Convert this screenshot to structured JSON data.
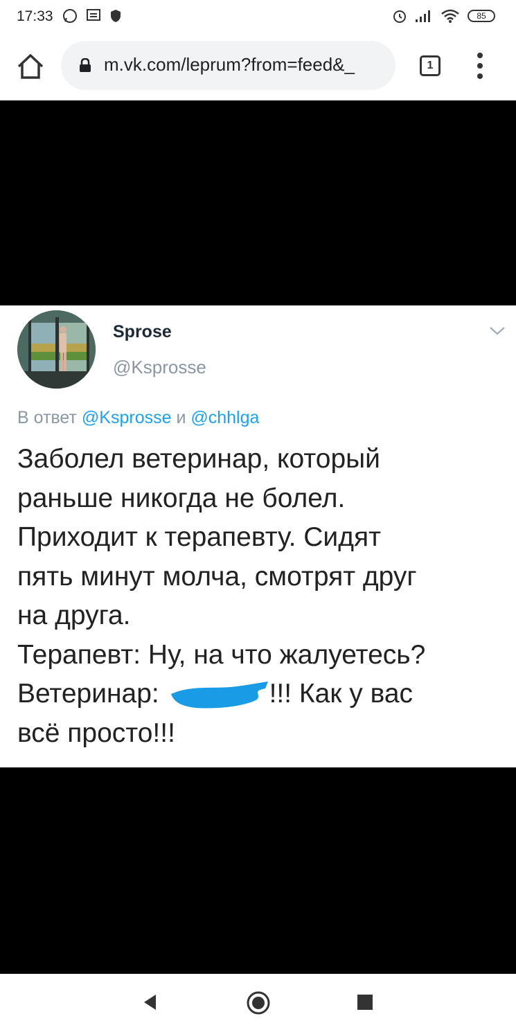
{
  "status_bar": {
    "time": "17:33",
    "battery": "85",
    "icons": [
      "whatsapp-icon",
      "message-icon",
      "shield-icon",
      "alarm-icon",
      "signal-icon",
      "wifi-icon",
      "battery-icon"
    ]
  },
  "browser": {
    "url": "m.vk.com/leprum?from=feed&_",
    "tab_count": "1",
    "icons": [
      "home-icon",
      "lock-icon",
      "tab-switcher-icon",
      "more-menu-icon"
    ]
  },
  "tweet": {
    "author_name": "Sprose",
    "author_handle": "@Ksprosse",
    "reply_prefix": "В ответ",
    "reply_user1": "@Ksprosse",
    "reply_conj": "и",
    "reply_user2": "@chhlga",
    "lines": [
      "Заболел ветеринар, который",
      "раньше никогда не болел.",
      "Приходит к терапевту. Сидят",
      "пять минут молча, смотрят друг",
      "на друга.",
      "Терапевт: Ну, на что жалуетесь?"
    ],
    "line7_start": "Ветеринар: ",
    "line7_end": "!!! Как у вас",
    "line8": "всё просто!!!",
    "colors": {
      "mention": "#1da1f2",
      "secondary": "#8a98a5",
      "scribble": "#1a9be6"
    }
  },
  "nav": {
    "icons": [
      "back-icon",
      "home-icon",
      "recents-icon"
    ]
  }
}
